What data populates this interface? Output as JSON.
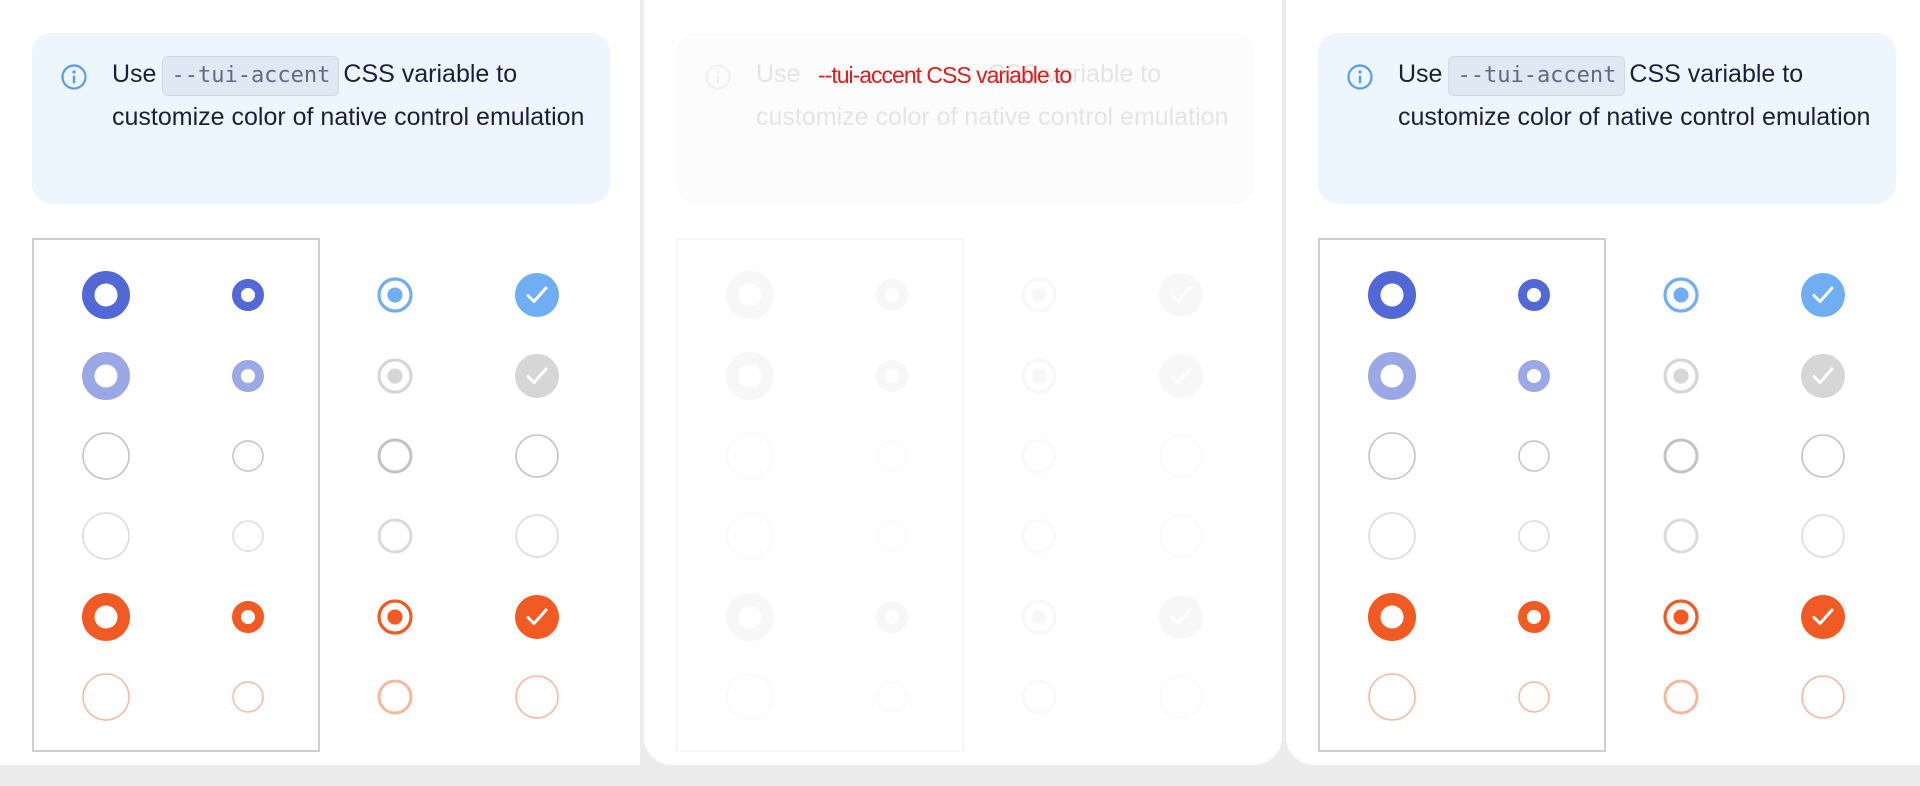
{
  "notice": {
    "prefix": "Use",
    "code": "--tui-accent",
    "suffix": "CSS variable to customize color of native control emulation",
    "icon": "info-icon",
    "accent": "#5a9bf0"
  },
  "ghost_overlay": "--tui-accent CSS variable to",
  "colors": {
    "primary": "#5168d6",
    "primary_light": "#9aa8e6",
    "blue": "#6faef3",
    "gray_disabled": "#d6d6d6",
    "gray_border": "#c2c2c2",
    "gray_border_light": "#dadada",
    "orange": "#f25a24",
    "orange_light": "#f8b79d"
  },
  "rows": [
    {
      "state": "checked"
    },
    {
      "state": "checked-disabled"
    },
    {
      "state": "unchecked"
    },
    {
      "state": "unchecked-disabled"
    },
    {
      "state": "invalid-checked"
    },
    {
      "state": "invalid-unchecked-disabled"
    }
  ]
}
